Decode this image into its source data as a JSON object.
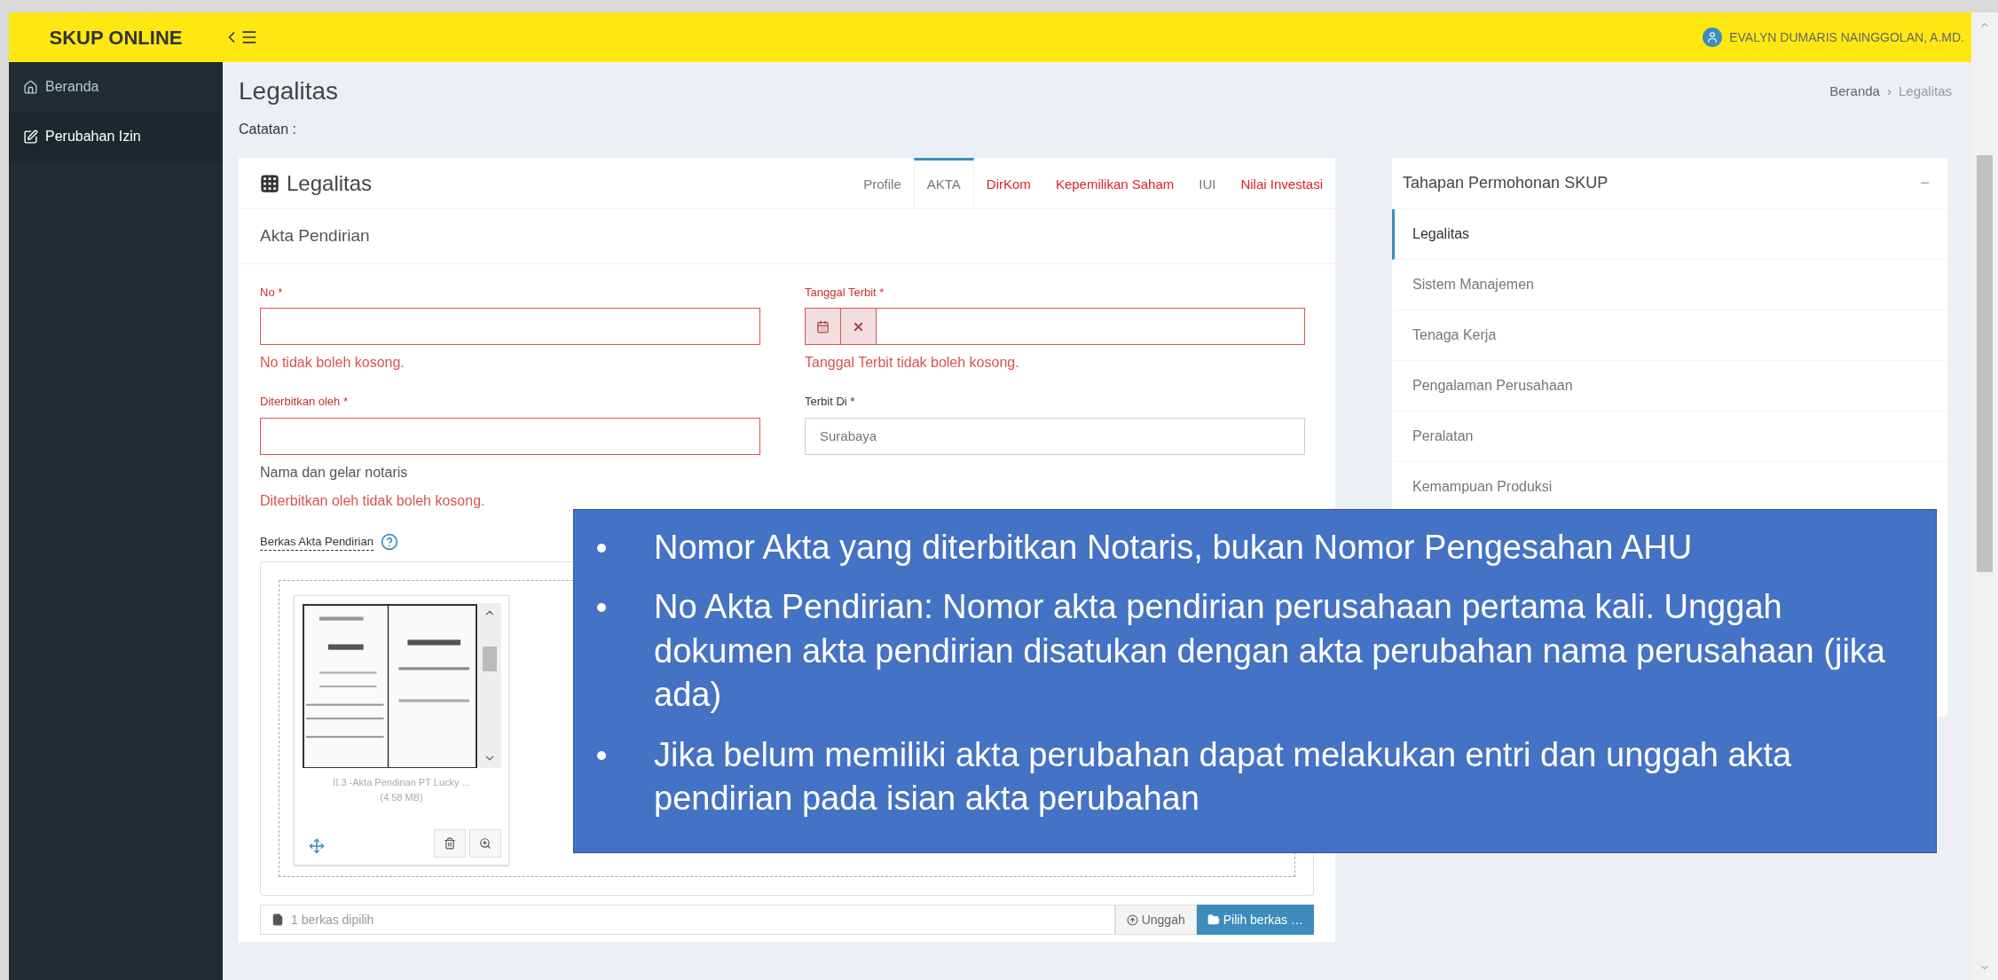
{
  "header": {
    "brand": "SKUP ONLINE",
    "user": "EVALYN DUMARIS NAINGGOLAN, A.MD."
  },
  "sidebar": {
    "items": [
      {
        "label": "Beranda",
        "selected": false
      },
      {
        "label": "Perubahan Izin",
        "selected": true
      }
    ]
  },
  "page": {
    "title": "Legalitas",
    "breadcrumb": [
      "Beranda",
      "Legalitas"
    ],
    "breadcrumb_separator": "›",
    "note": "Catatan :"
  },
  "main_card": {
    "title": "Legalitas",
    "tabs": [
      {
        "label": "Profile",
        "selected": false,
        "error": false
      },
      {
        "label": "AKTA",
        "selected": true,
        "error": false
      },
      {
        "label": "DirKom",
        "selected": false,
        "error": true
      },
      {
        "label": "Kepemilikan Saham",
        "selected": false,
        "error": true
      },
      {
        "label": "IUI",
        "selected": false,
        "error": false
      },
      {
        "label": "Nilai Investasi",
        "selected": false,
        "error": true
      }
    ],
    "section_title": "Akta Pendirian",
    "fields": [
      {
        "kind": "text",
        "label": "No *",
        "invalid": true,
        "error": "No tidak boleh kosong."
      },
      {
        "kind": "date",
        "label": "Tanggal Terbit *",
        "invalid": true,
        "error": "Tanggal Terbit tidak boleh kosong."
      },
      {
        "kind": "text",
        "label": "Diterbitkan oleh *",
        "invalid": true,
        "help": "Nama dan gelar notaris",
        "error": "Diterbitkan oleh tidak boleh kosong."
      },
      {
        "kind": "text",
        "label": "Terbit Di *",
        "invalid": false,
        "value": "Surabaya"
      }
    ],
    "upload": {
      "label": "Berkas Akta Pendirian",
      "file_caption": "II.3 -Akta Pendirian PT Lucky ...",
      "file_size": "(4.58 MB)",
      "status": "1 berkas dipilih",
      "buttons": [
        "Unggah",
        "Pilih berkas …"
      ]
    }
  },
  "steps_card": {
    "title": "Tahapan Permohonan SKUP",
    "collapse": "−",
    "items": [
      {
        "label": "Legalitas",
        "selected": true
      },
      {
        "label": "Sistem Manajemen",
        "selected": false
      },
      {
        "label": "Tenaga Kerja",
        "selected": false
      },
      {
        "label": "Pengalaman Perusahaan",
        "selected": false
      },
      {
        "label": "Peralatan",
        "selected": false
      },
      {
        "label": "Kemampuan Produksi",
        "selected": false
      }
    ]
  },
  "callout": {
    "bullets": [
      "Nomor Akta yang diterbitkan Notaris, bukan Nomor Pengesahan AHU",
      "No Akta Pendirian: Nomor akta pendirian perusahaan  pertama kali. Unggah dokumen akta pendirian disatukan dengan akta perubahan nama perusahaan (jika ada)",
      "Jika belum memiliki akta perubahan dapat melakukan entri dan unggah akta pendirian pada isian akta perubahan"
    ]
  }
}
